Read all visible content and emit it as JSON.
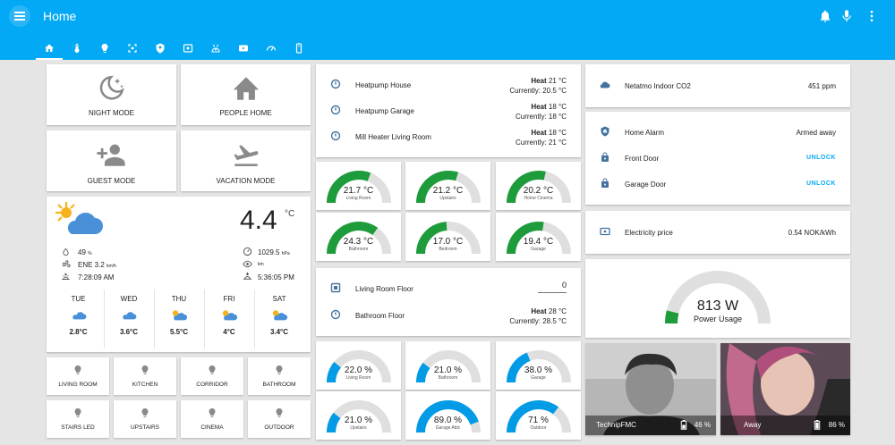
{
  "header": {
    "title": "Home",
    "tabs": [
      "home",
      "thermometer",
      "lightbulb",
      "scan",
      "shield",
      "alarm",
      "robot",
      "youtube",
      "speedometer",
      "remote"
    ]
  },
  "scenes": [
    {
      "label": "NIGHT MODE",
      "icon": "night-icon"
    },
    {
      "label": "PEOPLE HOME",
      "icon": "house-icon"
    },
    {
      "label": "GUEST MODE",
      "icon": "add-user-icon"
    },
    {
      "label": "VACATION MODE",
      "icon": "airplane-takeoff-icon"
    }
  ],
  "weather": {
    "temperature": "4.4",
    "unit": "°C",
    "humidity": "49",
    "humidity_unit": "%",
    "wind": "ENE 3.2",
    "wind_unit": "km/h",
    "sunrise": "7:28:09 AM",
    "pressure": "1029.5",
    "pressure_unit": "hPa",
    "visibility_unit": "km",
    "sunset": "5:36:05 PM",
    "forecast": [
      {
        "day": "TUE",
        "temp": "2.8°C",
        "icon": "cloudy-icon"
      },
      {
        "day": "WED",
        "temp": "3.6°C",
        "icon": "cloudy-icon"
      },
      {
        "day": "THU",
        "temp": "5.5°C",
        "icon": "partly-cloudy-icon"
      },
      {
        "day": "FRI",
        "temp": "4°C",
        "icon": "partly-cloudy-icon"
      },
      {
        "day": "SAT",
        "temp": "3.4°C",
        "icon": "partly-cloudy-icon"
      }
    ]
  },
  "lights": [
    "LIVING ROOM",
    "KITCHEN",
    "CORRIDOR",
    "BATHROOM",
    "STAIRS LED",
    "UPSTAIRS",
    "CINEMA",
    "OUTDOOR"
  ],
  "climate": [
    {
      "name": "Heatpump House",
      "mode": "Heat",
      "target": "21 °C",
      "current": "Currently: 20.5 °C"
    },
    {
      "name": "Heatpump Garage",
      "mode": "Heat",
      "target": "18 °C",
      "current": "Currently: 18 °C"
    },
    {
      "name": "Mill Heater Living Room",
      "mode": "Heat",
      "target": "18 °C",
      "current": "Currently: 21 °C"
    }
  ],
  "temp_gauges": [
    {
      "value": "21.7 °C",
      "name": "Living Room",
      "level": 0.62
    },
    {
      "value": "21.2 °C",
      "name": "Upstairs",
      "level": 0.6
    },
    {
      "value": "20.2 °C",
      "name": "Home Cinema",
      "level": 0.57
    },
    {
      "value": "24.3 °C",
      "name": "Bathroom",
      "level": 0.7
    },
    {
      "value": "17.0 °C",
      "name": "Bedroom",
      "level": 0.48
    },
    {
      "value": "19.4 °C",
      "name": "Garage",
      "level": 0.55
    }
  ],
  "floor": {
    "living_label": "Living Room Floor",
    "living_value": "0",
    "bathroom_label": "Bathroom Floor",
    "bathroom_mode": "Heat",
    "bathroom_target": "28 °C",
    "bathroom_current": "Currently: 28.5 °C"
  },
  "humidity_gauges": [
    {
      "value": "22.0 %",
      "name": "Living Room",
      "level": 0.22
    },
    {
      "value": "21.0 %",
      "name": "Bathroom",
      "level": 0.21
    },
    {
      "value": "38.0 %",
      "name": "Garage",
      "level": 0.38
    },
    {
      "value": "21.0 %",
      "name": "Upstairs",
      "level": 0.21
    },
    {
      "value": "89.0 %",
      "name": "Garage Attic",
      "level": 0.89
    },
    {
      "value": "71 %",
      "name": "Outdoor",
      "level": 0.71
    }
  ],
  "co2": {
    "name": "Netatmo Indoor CO2",
    "value": "451 ppm"
  },
  "security": [
    {
      "name": "Home Alarm",
      "value": "Armed away",
      "icon": "shield-home-icon"
    },
    {
      "name": "Front Door",
      "value": "UNLOCK",
      "icon": "lock-icon"
    },
    {
      "name": "Garage Door",
      "value": "UNLOCK",
      "icon": "lock-icon"
    }
  ],
  "electricity": {
    "name": "Electricity price",
    "value": "0.54 NOK/kWh"
  },
  "power": {
    "value": "813 W",
    "name": "Power Usage",
    "level": 0.08
  },
  "people": [
    {
      "name": "TechnipFMC",
      "battery": "46 %"
    },
    {
      "name": "Away",
      "battery": "86 %"
    }
  ],
  "colors": {
    "accent": "#03a9f4",
    "gauge_green": "#1e9c3b",
    "gauge_blue": "#039be5",
    "gauge_track": "#dfdfdf"
  }
}
